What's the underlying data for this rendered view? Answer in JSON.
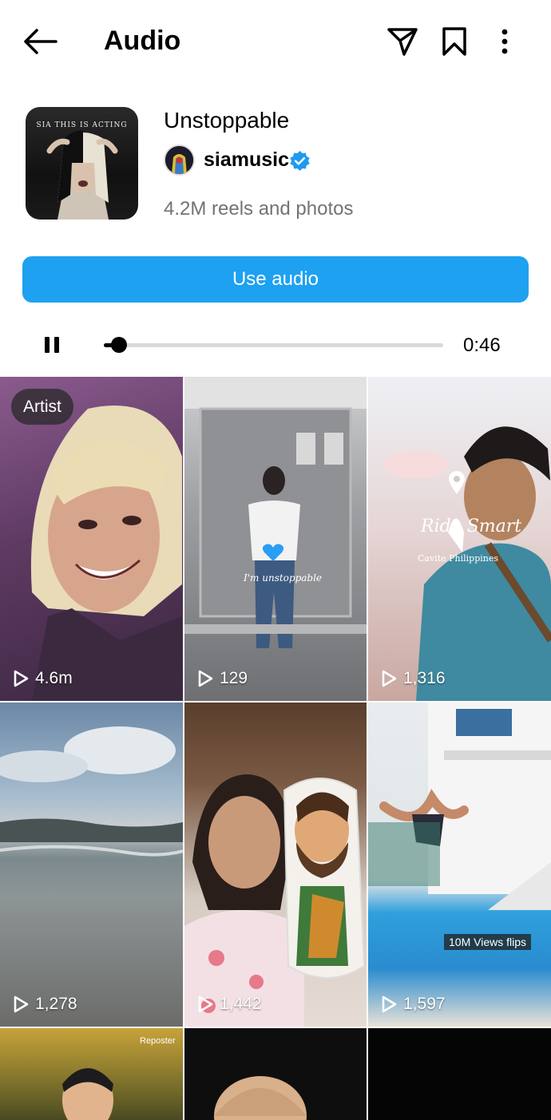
{
  "header": {
    "title": "Audio",
    "back_icon": "arrow-left-icon",
    "share_icon": "paper-plane-icon",
    "save_icon": "bookmark-icon",
    "more_icon": "more-vertical-icon"
  },
  "track": {
    "cover_text": "SIA THIS IS ACTING",
    "title": "Unstoppable",
    "artist": "siamusic",
    "verified_icon": "verified-badge-icon",
    "count": "4.2M reels and photos"
  },
  "use_audio_label": "Use audio",
  "player": {
    "state_icon": "pause-icon",
    "progress": 0.045,
    "time_remaining": "0:46"
  },
  "grid": [
    {
      "views": "4.6m",
      "badge": "Artist"
    },
    {
      "views": "129",
      "overlay": "I'm unstoppable"
    },
    {
      "views": "1,316",
      "overlay_title": "Ride Smart",
      "overlay_sub": "Cavite Philippines"
    },
    {
      "views": "1,278"
    },
    {
      "views": "1,442"
    },
    {
      "views": "1,597",
      "overlay": "10M Views flips"
    },
    {
      "overlay": "Reposter"
    },
    {},
    {}
  ],
  "colors": {
    "accent": "#1ea1f1",
    "verified": "#1d9bf0",
    "secondary_text": "#737373"
  }
}
